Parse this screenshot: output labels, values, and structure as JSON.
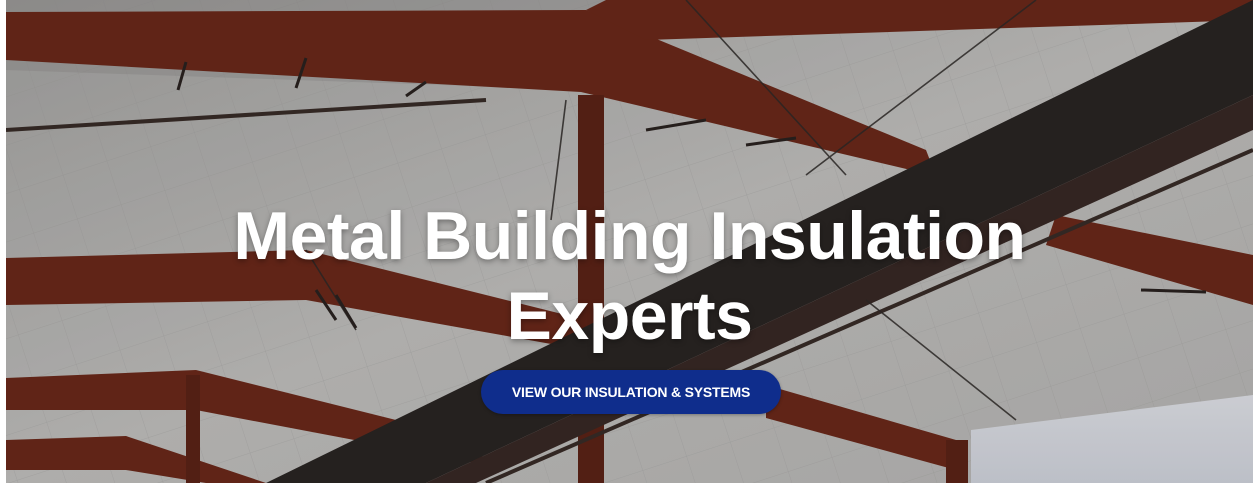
{
  "hero": {
    "title_line1": "Metal Building Insulation",
    "title_line2": "Experts",
    "cta_label": "VIEW OUR INSULATION & SYSTEMS"
  },
  "colors": {
    "cta_background": "#0f2d8c",
    "beam": "#6e2a1b",
    "ceiling": "#c9c8c6"
  },
  "background_image": "metal-building-interior-photo"
}
